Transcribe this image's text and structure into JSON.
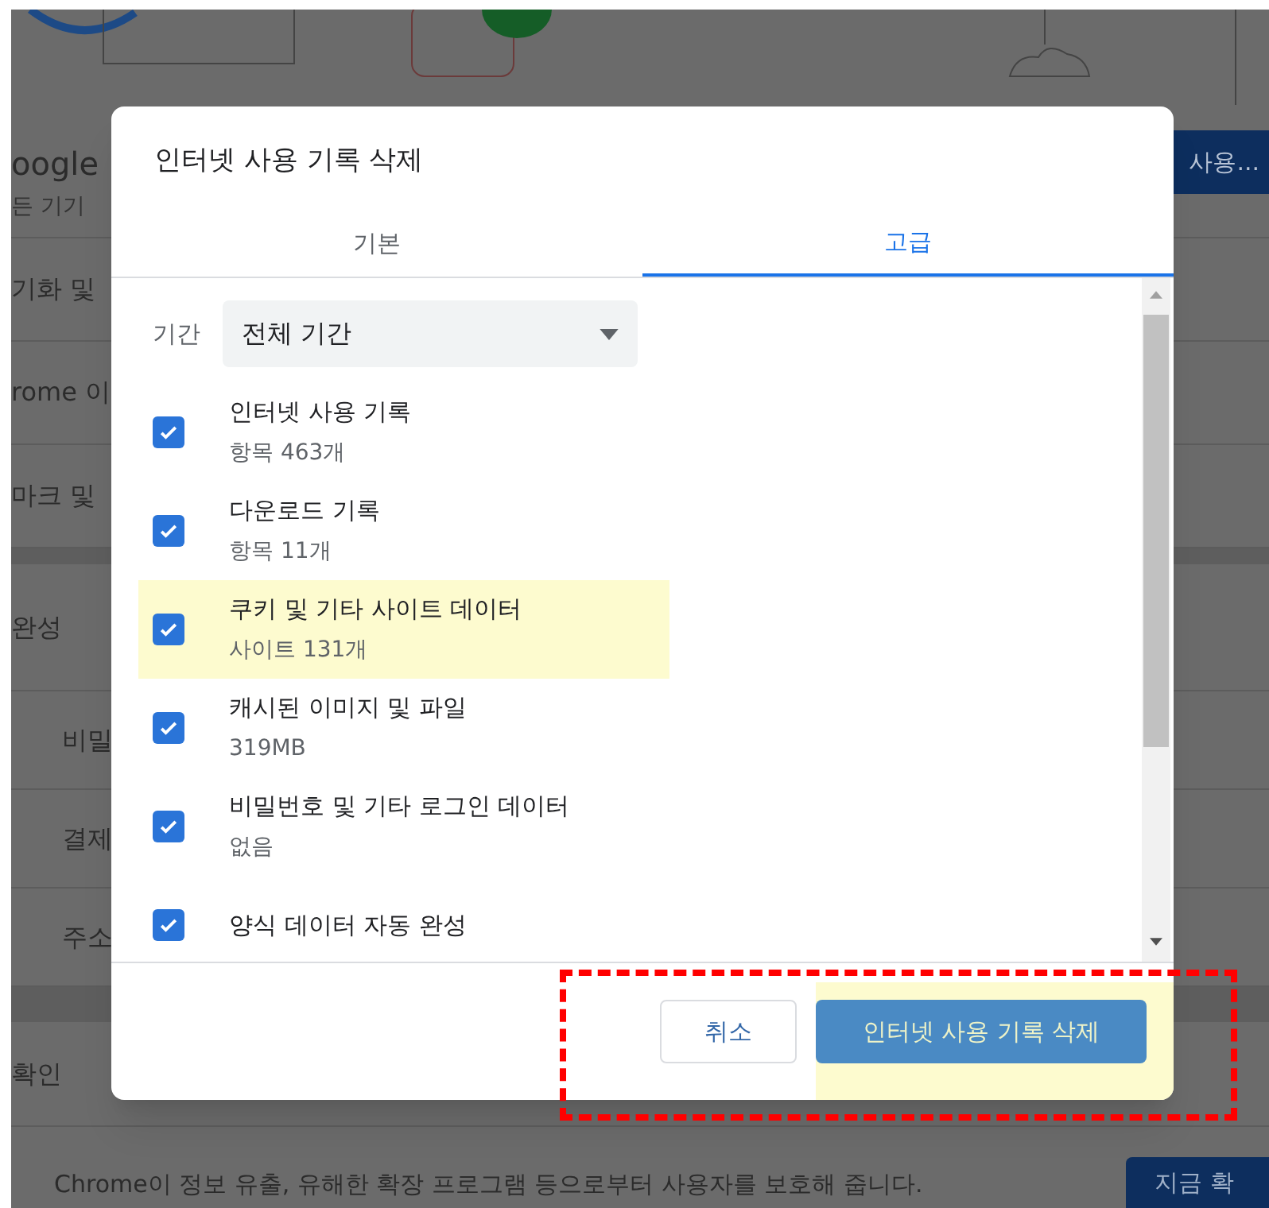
{
  "background": {
    "heading": "oogle",
    "subheading": "든 기기",
    "top_button": "사용...",
    "rows": [
      "기화 및",
      "rome 이",
      "마크 및"
    ],
    "section": "완성",
    "sub_rows": [
      "비밀",
      "결제",
      "주소"
    ],
    "check_row": "확인",
    "notice": "Chrome이 정보 유출, 유해한 확장 프로그램 등으로부터 사용자를 보호해 줍니다.",
    "check_button": "지금 확"
  },
  "dialog": {
    "title": "인터넷 사용 기록 삭제",
    "tabs": [
      {
        "label": "기본",
        "selected": false
      },
      {
        "label": "고급",
        "selected": true
      }
    ],
    "period": {
      "label": "기간",
      "value": "전체 기간"
    },
    "items": [
      {
        "label": "인터넷 사용 기록",
        "detail": "항목 463개",
        "checked": true,
        "highlighted": false
      },
      {
        "label": "다운로드 기록",
        "detail": "항목 11개",
        "checked": true,
        "highlighted": false
      },
      {
        "label": "쿠키 및 기타 사이트 데이터",
        "detail": "사이트 131개",
        "checked": true,
        "highlighted": true
      },
      {
        "label": "캐시된 이미지 및 파일",
        "detail": "319MB",
        "checked": true,
        "highlighted": false
      },
      {
        "label": "비밀번호 및 기타 로그인 데이터",
        "detail": "없음",
        "checked": true,
        "highlighted": false
      },
      {
        "label": "양식 데이터 자동 완성",
        "checked": true,
        "highlighted": false
      }
    ],
    "buttons": [
      {
        "label": "취소",
        "kind": "secondary",
        "highlighted": false
      },
      {
        "label": "인터넷 사용 기록 삭제",
        "kind": "primary",
        "highlighted": true
      }
    ]
  }
}
